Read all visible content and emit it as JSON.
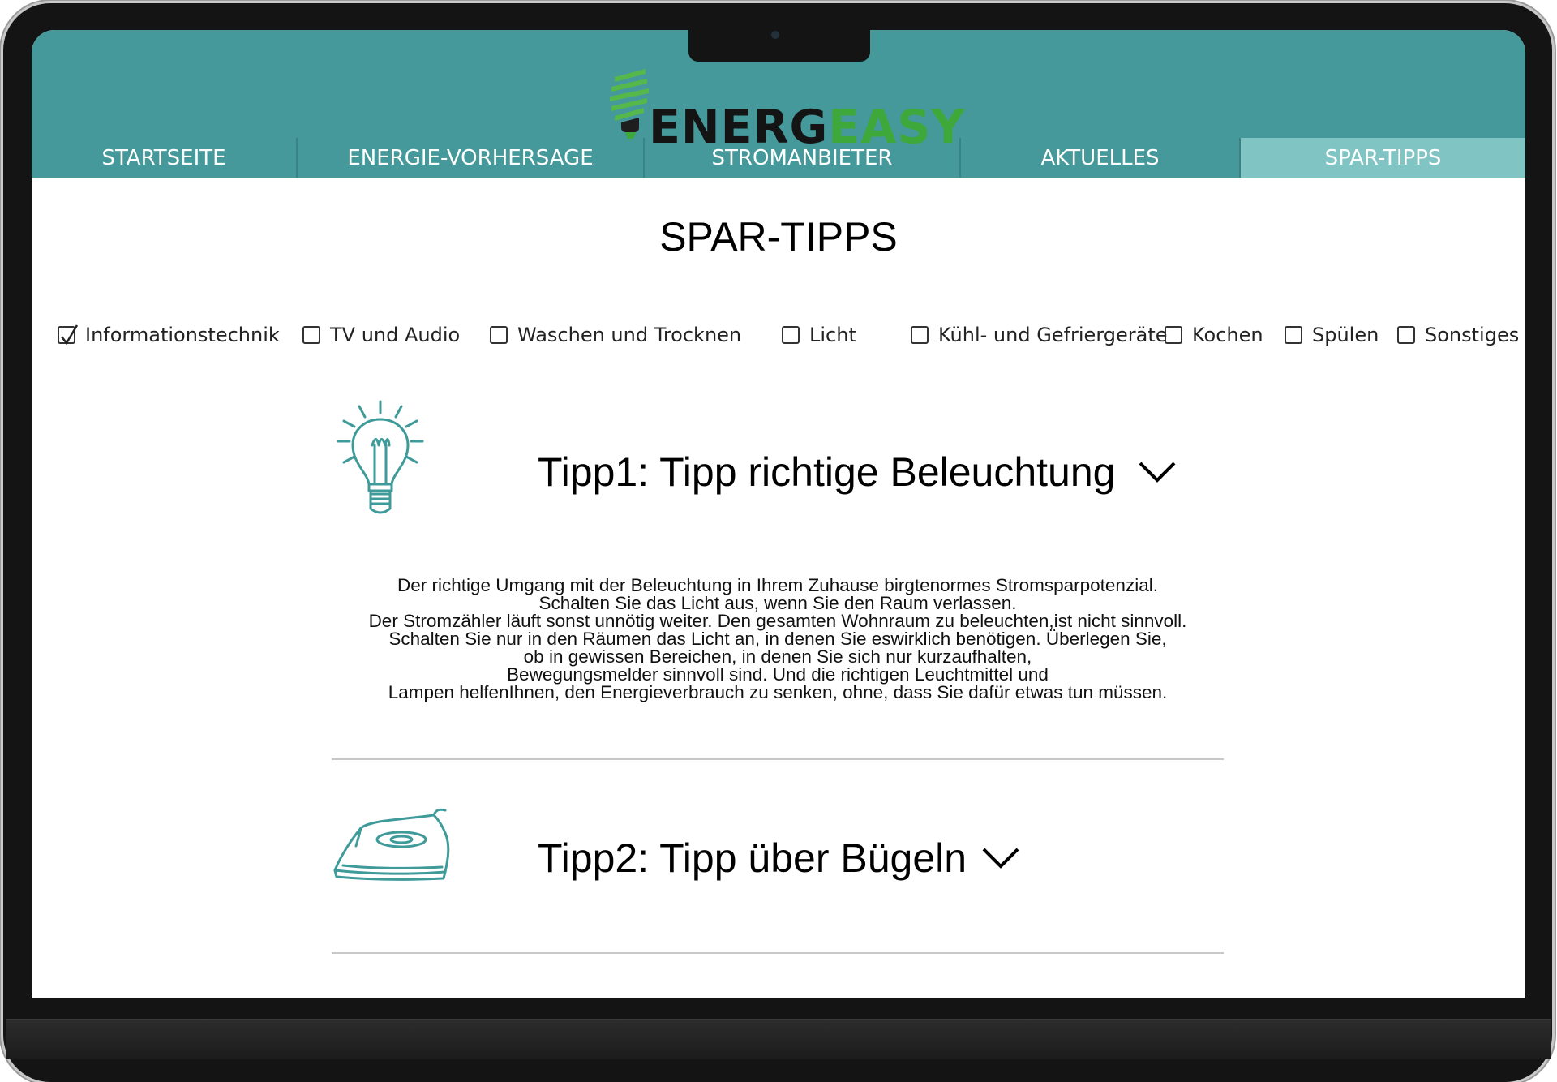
{
  "app": {
    "logo": {
      "part1": "ENERG",
      "part2": "EASY"
    },
    "nav": [
      {
        "label": "STARTSEITE",
        "active": false
      },
      {
        "label": "ENERGIE-VORHERSAGE",
        "active": false
      },
      {
        "label": "STROMANBIETER",
        "active": false
      },
      {
        "label": "AKTUELLES",
        "active": false
      },
      {
        "label": "SPAR-TIPPS",
        "active": true
      }
    ]
  },
  "colors": {
    "header": "#45999a",
    "nav_active": "#81c4c4",
    "icon_teal": "#3f9a9a",
    "logo_green": "#3ea83a"
  },
  "page": {
    "title": "SPAR-TIPPS",
    "filters": [
      {
        "label": "Informationstechnik",
        "checked": true
      },
      {
        "label": "TV und Audio",
        "checked": false
      },
      {
        "label": "Waschen und Trocknen",
        "checked": false
      },
      {
        "label": "Licht",
        "checked": false
      },
      {
        "label": "Kühl- und Gefriergeräte",
        "checked": false
      },
      {
        "label": "Kochen",
        "checked": false
      },
      {
        "label": "Spülen",
        "checked": false
      },
      {
        "label": "Sonstiges",
        "checked": false
      }
    ],
    "tips": [
      {
        "title": "Tipp1: Tipp richtige Beleuchtung",
        "icon": "lightbulb-icon",
        "expanded": true,
        "body": [
          "Der richtige Umgang mit der Beleuchtung in Ihrem Zuhause birgtenormes Stromsparpotenzial.",
          "Schalten Sie das Licht aus, wenn Sie den Raum verlassen.",
          "Der Stromzähler läuft sonst unnötig weiter. Den gesamten Wohnraum zu beleuchten,ist nicht sinnvoll.",
          "Schalten Sie nur in den Räumen das Licht an, in denen Sie eswirklich benötigen. Überlegen Sie,",
          "ob in gewissen Bereichen, in denen Sie sich nur kurzaufhalten,",
          "Bewegungsmelder sinnvoll sind. Und die richtigen Leuchtmittel und",
          "Lampen helfenIhnen, den Energieverbrauch zu senken, ohne, dass Sie dafür etwas tun müssen."
        ]
      },
      {
        "title": "Tipp2: Tipp über Bügeln",
        "icon": "iron-icon",
        "expanded": false
      }
    ]
  }
}
